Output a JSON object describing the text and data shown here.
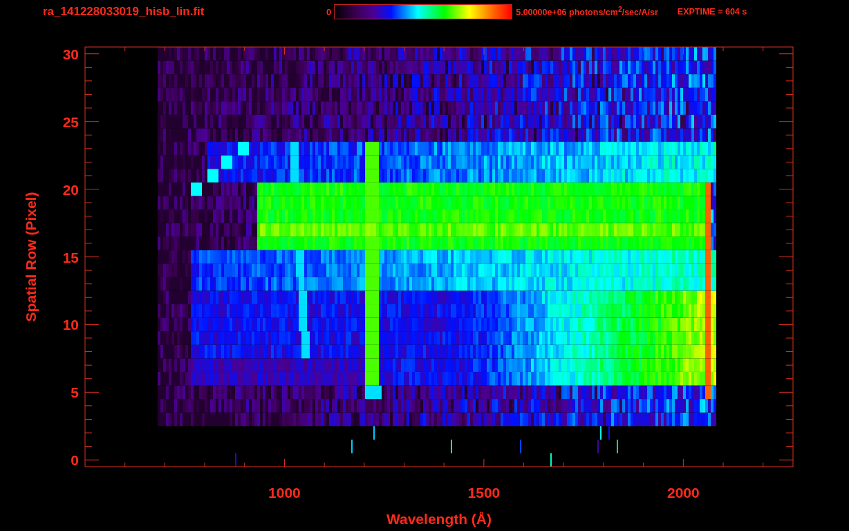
{
  "title": "ra_141228033019_hisb_lin.fit",
  "colorbar": {
    "min_label": "0",
    "max_label": "5.00000e+06 photons/cm$^{2}$/sec/A/sr"
  },
  "exposure": "EXPTIME = 604 s",
  "plot": {
    "xlabel": "Wavelength (Å)",
    "ylabel": "Spatial Row (Pixel)",
    "xticks": [
      "1000",
      "1500",
      "2000"
    ],
    "yticks": [
      "30",
      "25",
      "20",
      "15",
      "10",
      "5",
      "0"
    ]
  }
}
